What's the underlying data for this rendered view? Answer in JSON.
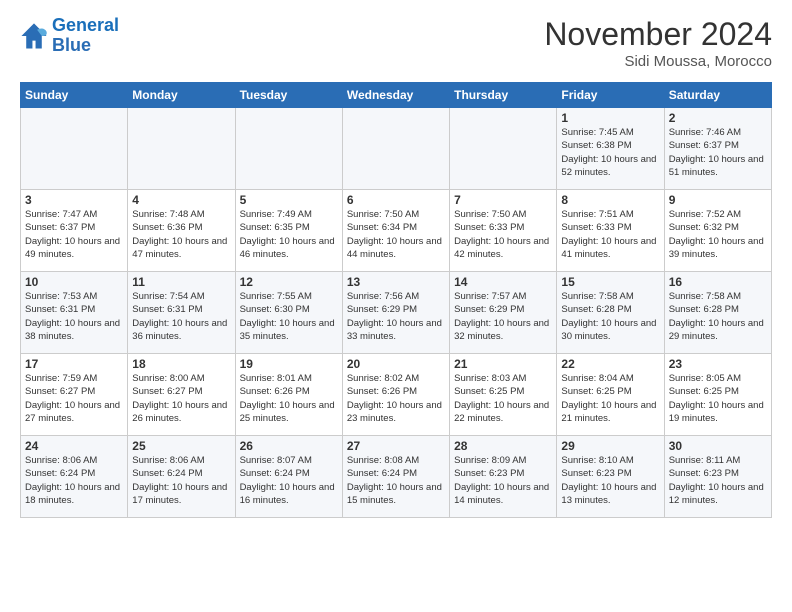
{
  "header": {
    "logo_line1": "General",
    "logo_line2": "Blue",
    "month": "November 2024",
    "location": "Sidi Moussa, Morocco"
  },
  "days_of_week": [
    "Sunday",
    "Monday",
    "Tuesday",
    "Wednesday",
    "Thursday",
    "Friday",
    "Saturday"
  ],
  "weeks": [
    [
      {
        "day": "",
        "info": ""
      },
      {
        "day": "",
        "info": ""
      },
      {
        "day": "",
        "info": ""
      },
      {
        "day": "",
        "info": ""
      },
      {
        "day": "",
        "info": ""
      },
      {
        "day": "1",
        "info": "Sunrise: 7:45 AM\nSunset: 6:38 PM\nDaylight: 10 hours and 52 minutes."
      },
      {
        "day": "2",
        "info": "Sunrise: 7:46 AM\nSunset: 6:37 PM\nDaylight: 10 hours and 51 minutes."
      }
    ],
    [
      {
        "day": "3",
        "info": "Sunrise: 7:47 AM\nSunset: 6:37 PM\nDaylight: 10 hours and 49 minutes."
      },
      {
        "day": "4",
        "info": "Sunrise: 7:48 AM\nSunset: 6:36 PM\nDaylight: 10 hours and 47 minutes."
      },
      {
        "day": "5",
        "info": "Sunrise: 7:49 AM\nSunset: 6:35 PM\nDaylight: 10 hours and 46 minutes."
      },
      {
        "day": "6",
        "info": "Sunrise: 7:50 AM\nSunset: 6:34 PM\nDaylight: 10 hours and 44 minutes."
      },
      {
        "day": "7",
        "info": "Sunrise: 7:50 AM\nSunset: 6:33 PM\nDaylight: 10 hours and 42 minutes."
      },
      {
        "day": "8",
        "info": "Sunrise: 7:51 AM\nSunset: 6:33 PM\nDaylight: 10 hours and 41 minutes."
      },
      {
        "day": "9",
        "info": "Sunrise: 7:52 AM\nSunset: 6:32 PM\nDaylight: 10 hours and 39 minutes."
      }
    ],
    [
      {
        "day": "10",
        "info": "Sunrise: 7:53 AM\nSunset: 6:31 PM\nDaylight: 10 hours and 38 minutes."
      },
      {
        "day": "11",
        "info": "Sunrise: 7:54 AM\nSunset: 6:31 PM\nDaylight: 10 hours and 36 minutes."
      },
      {
        "day": "12",
        "info": "Sunrise: 7:55 AM\nSunset: 6:30 PM\nDaylight: 10 hours and 35 minutes."
      },
      {
        "day": "13",
        "info": "Sunrise: 7:56 AM\nSunset: 6:29 PM\nDaylight: 10 hours and 33 minutes."
      },
      {
        "day": "14",
        "info": "Sunrise: 7:57 AM\nSunset: 6:29 PM\nDaylight: 10 hours and 32 minutes."
      },
      {
        "day": "15",
        "info": "Sunrise: 7:58 AM\nSunset: 6:28 PM\nDaylight: 10 hours and 30 minutes."
      },
      {
        "day": "16",
        "info": "Sunrise: 7:58 AM\nSunset: 6:28 PM\nDaylight: 10 hours and 29 minutes."
      }
    ],
    [
      {
        "day": "17",
        "info": "Sunrise: 7:59 AM\nSunset: 6:27 PM\nDaylight: 10 hours and 27 minutes."
      },
      {
        "day": "18",
        "info": "Sunrise: 8:00 AM\nSunset: 6:27 PM\nDaylight: 10 hours and 26 minutes."
      },
      {
        "day": "19",
        "info": "Sunrise: 8:01 AM\nSunset: 6:26 PM\nDaylight: 10 hours and 25 minutes."
      },
      {
        "day": "20",
        "info": "Sunrise: 8:02 AM\nSunset: 6:26 PM\nDaylight: 10 hours and 23 minutes."
      },
      {
        "day": "21",
        "info": "Sunrise: 8:03 AM\nSunset: 6:25 PM\nDaylight: 10 hours and 22 minutes."
      },
      {
        "day": "22",
        "info": "Sunrise: 8:04 AM\nSunset: 6:25 PM\nDaylight: 10 hours and 21 minutes."
      },
      {
        "day": "23",
        "info": "Sunrise: 8:05 AM\nSunset: 6:25 PM\nDaylight: 10 hours and 19 minutes."
      }
    ],
    [
      {
        "day": "24",
        "info": "Sunrise: 8:06 AM\nSunset: 6:24 PM\nDaylight: 10 hours and 18 minutes."
      },
      {
        "day": "25",
        "info": "Sunrise: 8:06 AM\nSunset: 6:24 PM\nDaylight: 10 hours and 17 minutes."
      },
      {
        "day": "26",
        "info": "Sunrise: 8:07 AM\nSunset: 6:24 PM\nDaylight: 10 hours and 16 minutes."
      },
      {
        "day": "27",
        "info": "Sunrise: 8:08 AM\nSunset: 6:24 PM\nDaylight: 10 hours and 15 minutes."
      },
      {
        "day": "28",
        "info": "Sunrise: 8:09 AM\nSunset: 6:23 PM\nDaylight: 10 hours and 14 minutes."
      },
      {
        "day": "29",
        "info": "Sunrise: 8:10 AM\nSunset: 6:23 PM\nDaylight: 10 hours and 13 minutes."
      },
      {
        "day": "30",
        "info": "Sunrise: 8:11 AM\nSunset: 6:23 PM\nDaylight: 10 hours and 12 minutes."
      }
    ]
  ]
}
